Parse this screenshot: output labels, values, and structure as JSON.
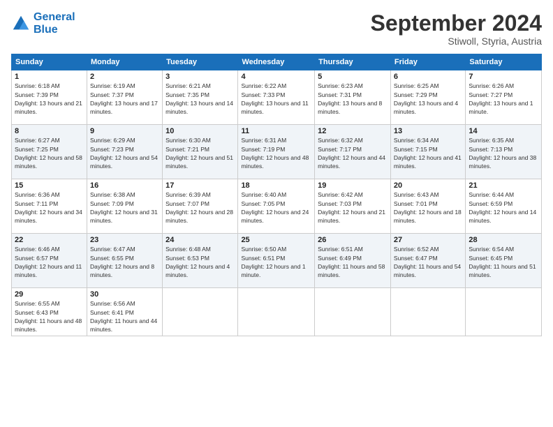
{
  "logo": {
    "text_general": "General",
    "text_blue": "Blue"
  },
  "title": "September 2024",
  "subtitle": "Stiwoll, Styria, Austria",
  "days_of_week": [
    "Sunday",
    "Monday",
    "Tuesday",
    "Wednesday",
    "Thursday",
    "Friday",
    "Saturday"
  ],
  "weeks": [
    [
      {
        "day": "1",
        "sunrise": "6:18 AM",
        "sunset": "7:39 PM",
        "daylight": "13 hours and 21 minutes."
      },
      {
        "day": "2",
        "sunrise": "6:19 AM",
        "sunset": "7:37 PM",
        "daylight": "13 hours and 17 minutes."
      },
      {
        "day": "3",
        "sunrise": "6:21 AM",
        "sunset": "7:35 PM",
        "daylight": "13 hours and 14 minutes."
      },
      {
        "day": "4",
        "sunrise": "6:22 AM",
        "sunset": "7:33 PM",
        "daylight": "13 hours and 11 minutes."
      },
      {
        "day": "5",
        "sunrise": "6:23 AM",
        "sunset": "7:31 PM",
        "daylight": "13 hours and 8 minutes."
      },
      {
        "day": "6",
        "sunrise": "6:25 AM",
        "sunset": "7:29 PM",
        "daylight": "13 hours and 4 minutes."
      },
      {
        "day": "7",
        "sunrise": "6:26 AM",
        "sunset": "7:27 PM",
        "daylight": "13 hours and 1 minute."
      }
    ],
    [
      {
        "day": "8",
        "sunrise": "6:27 AM",
        "sunset": "7:25 PM",
        "daylight": "12 hours and 58 minutes."
      },
      {
        "day": "9",
        "sunrise": "6:29 AM",
        "sunset": "7:23 PM",
        "daylight": "12 hours and 54 minutes."
      },
      {
        "day": "10",
        "sunrise": "6:30 AM",
        "sunset": "7:21 PM",
        "daylight": "12 hours and 51 minutes."
      },
      {
        "day": "11",
        "sunrise": "6:31 AM",
        "sunset": "7:19 PM",
        "daylight": "12 hours and 48 minutes."
      },
      {
        "day": "12",
        "sunrise": "6:32 AM",
        "sunset": "7:17 PM",
        "daylight": "12 hours and 44 minutes."
      },
      {
        "day": "13",
        "sunrise": "6:34 AM",
        "sunset": "7:15 PM",
        "daylight": "12 hours and 41 minutes."
      },
      {
        "day": "14",
        "sunrise": "6:35 AM",
        "sunset": "7:13 PM",
        "daylight": "12 hours and 38 minutes."
      }
    ],
    [
      {
        "day": "15",
        "sunrise": "6:36 AM",
        "sunset": "7:11 PM",
        "daylight": "12 hours and 34 minutes."
      },
      {
        "day": "16",
        "sunrise": "6:38 AM",
        "sunset": "7:09 PM",
        "daylight": "12 hours and 31 minutes."
      },
      {
        "day": "17",
        "sunrise": "6:39 AM",
        "sunset": "7:07 PM",
        "daylight": "12 hours and 28 minutes."
      },
      {
        "day": "18",
        "sunrise": "6:40 AM",
        "sunset": "7:05 PM",
        "daylight": "12 hours and 24 minutes."
      },
      {
        "day": "19",
        "sunrise": "6:42 AM",
        "sunset": "7:03 PM",
        "daylight": "12 hours and 21 minutes."
      },
      {
        "day": "20",
        "sunrise": "6:43 AM",
        "sunset": "7:01 PM",
        "daylight": "12 hours and 18 minutes."
      },
      {
        "day": "21",
        "sunrise": "6:44 AM",
        "sunset": "6:59 PM",
        "daylight": "12 hours and 14 minutes."
      }
    ],
    [
      {
        "day": "22",
        "sunrise": "6:46 AM",
        "sunset": "6:57 PM",
        "daylight": "12 hours and 11 minutes."
      },
      {
        "day": "23",
        "sunrise": "6:47 AM",
        "sunset": "6:55 PM",
        "daylight": "12 hours and 8 minutes."
      },
      {
        "day": "24",
        "sunrise": "6:48 AM",
        "sunset": "6:53 PM",
        "daylight": "12 hours and 4 minutes."
      },
      {
        "day": "25",
        "sunrise": "6:50 AM",
        "sunset": "6:51 PM",
        "daylight": "12 hours and 1 minute."
      },
      {
        "day": "26",
        "sunrise": "6:51 AM",
        "sunset": "6:49 PM",
        "daylight": "11 hours and 58 minutes."
      },
      {
        "day": "27",
        "sunrise": "6:52 AM",
        "sunset": "6:47 PM",
        "daylight": "11 hours and 54 minutes."
      },
      {
        "day": "28",
        "sunrise": "6:54 AM",
        "sunset": "6:45 PM",
        "daylight": "11 hours and 51 minutes."
      }
    ],
    [
      {
        "day": "29",
        "sunrise": "6:55 AM",
        "sunset": "6:43 PM",
        "daylight": "11 hours and 48 minutes."
      },
      {
        "day": "30",
        "sunrise": "6:56 AM",
        "sunset": "6:41 PM",
        "daylight": "11 hours and 44 minutes."
      },
      null,
      null,
      null,
      null,
      null
    ]
  ]
}
